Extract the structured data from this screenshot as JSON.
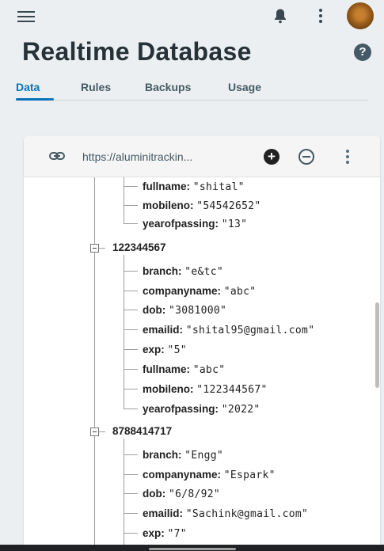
{
  "header": {
    "title": "Realtime Database",
    "help_glyph": "?",
    "menu_icon": "hamburger-menu-icon",
    "notification_icon": "bell-icon",
    "more_icon": "more-vert-icon"
  },
  "tabs": [
    {
      "label": "Data",
      "active": true
    },
    {
      "label": "Rules",
      "active": false
    },
    {
      "label": "Backups",
      "active": false
    },
    {
      "label": "Usage",
      "active": false
    }
  ],
  "db": {
    "url": "https://aluminitrackin...",
    "add_glyph": "+"
  },
  "tree": {
    "top_children": [
      {
        "key": "fullname",
        "value": "\"shital\""
      },
      {
        "key": "mobileno",
        "value": "\"54542652\""
      },
      {
        "key": "yearofpassing",
        "value": "\"13\""
      }
    ],
    "nodes": [
      {
        "key": "122344567",
        "children": [
          {
            "key": "branch",
            "value": "\"e&tc\""
          },
          {
            "key": "companyname",
            "value": "\"abc\""
          },
          {
            "key": "dob",
            "value": "\"3081000\""
          },
          {
            "key": "emailid",
            "value": "\"shital95@gmail.com\""
          },
          {
            "key": "exp",
            "value": "\"5\""
          },
          {
            "key": "fullname",
            "value": "\"abc\""
          },
          {
            "key": "mobileno",
            "value": "\"122344567\""
          },
          {
            "key": "yearofpassing",
            "value": "\"2022\""
          }
        ]
      },
      {
        "key": "8788414717",
        "children": [
          {
            "key": "branch",
            "value": "\"Engg\""
          },
          {
            "key": "companyname",
            "value": "\"Espark\""
          },
          {
            "key": "dob",
            "value": "\"6/8/92\""
          },
          {
            "key": "emailid",
            "value": "\"Sachink@gmail.com\""
          },
          {
            "key": "exp",
            "value": "\"7\""
          }
        ]
      }
    ]
  },
  "colors": {
    "accent": "#0b72b8",
    "background": "#eceff1",
    "card": "#ffffff"
  }
}
